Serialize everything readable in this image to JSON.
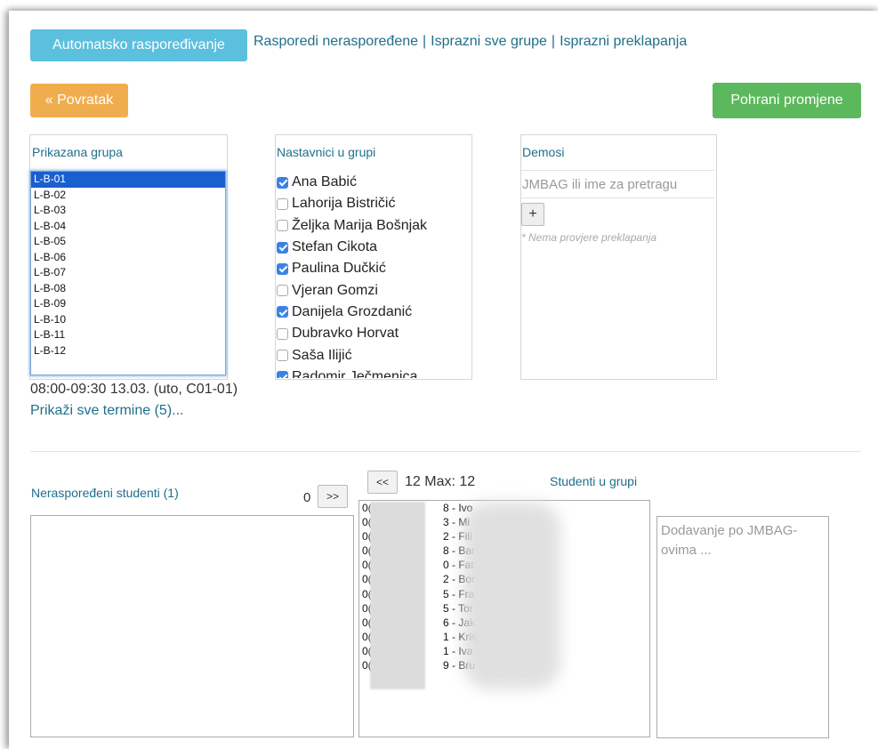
{
  "toolbar": {
    "auto_label": "Automatsko raspoređivanje",
    "links": [
      "Rasporedi neraspoređene",
      "Isprazni sve grupe",
      "Isprazni preklapanja"
    ],
    "separator": "|",
    "back_label": "« Povratak",
    "save_label": "Pohrani promjene"
  },
  "groups": {
    "title": "Prikazana grupa",
    "items": [
      "L-B-01",
      "L-B-02",
      "L-B-03",
      "L-B-04",
      "L-B-05",
      "L-B-06",
      "L-B-07",
      "L-B-08",
      "L-B-09",
      "L-B-10",
      "L-B-11",
      "L-B-12"
    ],
    "selected": "L-B-01",
    "term": "08:00-09:30 13.03. (uto, C01-01)",
    "show_all_terms": "Prikaži sve termine (5)..."
  },
  "teachers": {
    "title": "Nastavnici u grupi",
    "items": [
      {
        "name": "Ana Babić",
        "checked": true
      },
      {
        "name": "Lahorija Bistričić",
        "checked": false
      },
      {
        "name": "Željka Marija Bošnjak",
        "checked": false
      },
      {
        "name": "Stefan Cikota",
        "checked": true
      },
      {
        "name": "Paulina Dučkić",
        "checked": true
      },
      {
        "name": "Vjeran Gomzi",
        "checked": false
      },
      {
        "name": "Danijela Grozdanić",
        "checked": true
      },
      {
        "name": "Dubravko Horvat",
        "checked": false
      },
      {
        "name": "Saša Ilijić",
        "checked": false
      },
      {
        "name": "Radomir Ječmenica",
        "checked": true
      }
    ]
  },
  "demos": {
    "title": "Demosi",
    "search_placeholder": "JMBAG ili ime za pretragu",
    "add_label": "+",
    "note": "* Nema provjere preklapanja"
  },
  "unassigned": {
    "title": "Neraspoređeni studenti (1)",
    "count": "0",
    "move_right_label": ">>"
  },
  "ingroup": {
    "move_left_label": "<<",
    "count_label": "12 Max: 12",
    "title": "Studenti u grupi",
    "students": [
      {
        "prefix": "0(",
        "suffix": "8 - Ivo"
      },
      {
        "prefix": "0(",
        "suffix": "3 - Mi"
      },
      {
        "prefix": "0(",
        "suffix": "2 - Fili"
      },
      {
        "prefix": "0(",
        "suffix": "8 - Bar"
      },
      {
        "prefix": "0(",
        "suffix": "0 - Fat"
      },
      {
        "prefix": "0(",
        "suffix": "2 - Bor"
      },
      {
        "prefix": "0(",
        "suffix": "5 - Fra"
      },
      {
        "prefix": "0(",
        "suffix": "5 - Tor"
      },
      {
        "prefix": "0(",
        "suffix": "6 - Jak"
      },
      {
        "prefix": "0(",
        "suffix": "1 - Kris"
      },
      {
        "prefix": "0(",
        "suffix": "1 - Iva"
      },
      {
        "prefix": "0(",
        "suffix": "9 - Bru"
      }
    ]
  },
  "add_by_jmbag": {
    "placeholder": "Dodavanje po JMBAG-ovima ..."
  },
  "colors": {
    "info": "#5bc0de",
    "warning": "#f0ad4e",
    "success": "#5cb85c",
    "link": "#1f6f8b",
    "selection": "#1a5fd0",
    "checkbox": "#3b82e6"
  }
}
